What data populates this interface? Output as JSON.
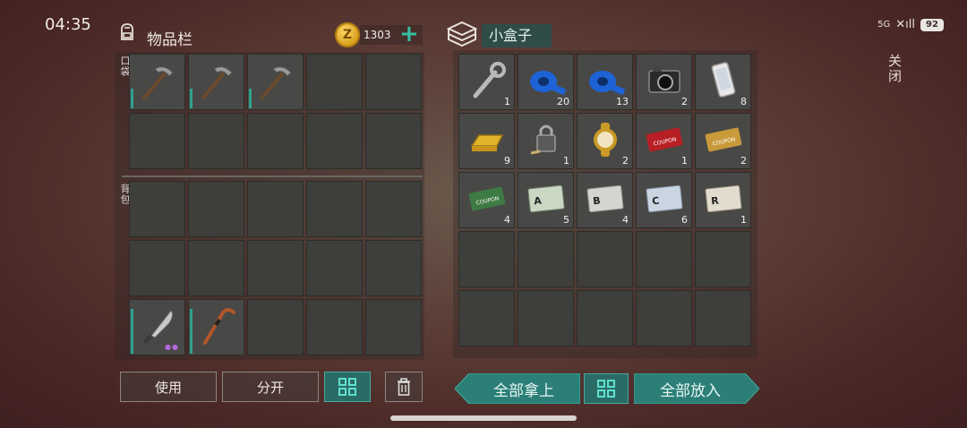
{
  "status_bar": {
    "time": "04:35",
    "network": "5G",
    "battery": "92"
  },
  "inventory": {
    "title": "物品栏",
    "money": "1303",
    "pocket_label": "口袋",
    "backpack_label": "背包",
    "coin_icon": "Z"
  },
  "box": {
    "title": "小盒子",
    "close_label": "关闭"
  },
  "box_items": [
    {
      "name": "wrench",
      "count": "1"
    },
    {
      "name": "blue-tape",
      "count": "20"
    },
    {
      "name": "blue-tape",
      "count": "13"
    },
    {
      "name": "camera",
      "count": "2"
    },
    {
      "name": "smartphone",
      "count": "8"
    },
    {
      "name": "gold-bar",
      "count": "9"
    },
    {
      "name": "padlock-key",
      "count": "1"
    },
    {
      "name": "gold-watch",
      "count": "2"
    },
    {
      "name": "combat-gear-coupon",
      "count": "1"
    },
    {
      "name": "gold-coupon",
      "count": "2"
    },
    {
      "name": "ration-coupon",
      "count": "4"
    },
    {
      "name": "army-card-a",
      "count": "5"
    },
    {
      "name": "army-card-b",
      "count": "4"
    },
    {
      "name": "army-card-c",
      "count": "6"
    },
    {
      "name": "army-card-r",
      "count": "1"
    }
  ],
  "buttons": {
    "use": "使用",
    "split": "分开",
    "take_all": "全部拿上",
    "put_all": "全部放入"
  }
}
